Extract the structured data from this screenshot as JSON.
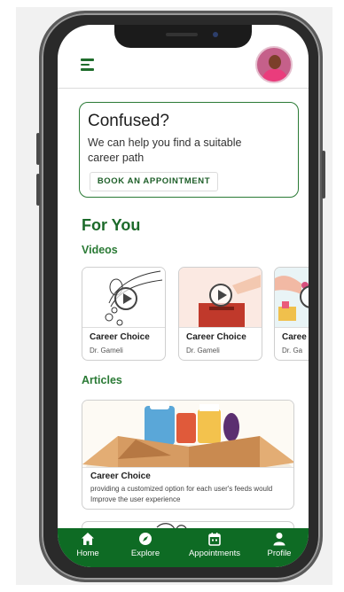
{
  "confused_card": {
    "title": "Confused?",
    "description": "We can help you find a suitable career path",
    "button_label": "BOOK AN APPOINTMENT"
  },
  "for_you_heading": "For You",
  "videos": {
    "label": "Videos",
    "items": [
      {
        "title": "Career Choice",
        "author": "Dr. Gameli"
      },
      {
        "title": "Career Choice",
        "author": "Dr. Gameli"
      },
      {
        "title": "Caree",
        "author": "Dr. Ga"
      }
    ]
  },
  "articles": {
    "label": "Articles",
    "items": [
      {
        "title": "Career Choice",
        "description": "providing a customized option for each user's feeds would Improve the user experience"
      }
    ]
  },
  "bottom_nav": [
    {
      "label": "Home",
      "icon": "home-icon"
    },
    {
      "label": "Explore",
      "icon": "compass-icon"
    },
    {
      "label": "Appointments",
      "icon": "calendar-icon"
    },
    {
      "label": "Profile",
      "icon": "person-icon"
    }
  ],
  "colors": {
    "primary_green": "#0e6b24",
    "accent_green": "#2a7a35",
    "heading_green": "#1c6a2a"
  }
}
